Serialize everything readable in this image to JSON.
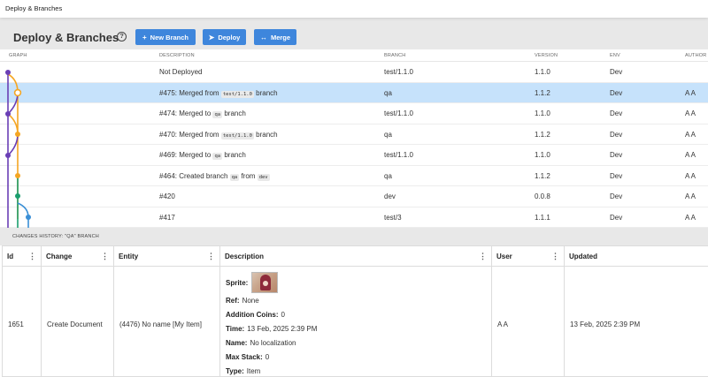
{
  "window": {
    "title": "Deploy & Branches"
  },
  "header": {
    "title": "Deploy & Branches",
    "help_icon": "?",
    "buttons": [
      {
        "label": "New Branch",
        "icon": "+"
      },
      {
        "label": "Deploy",
        "icon": "➤"
      },
      {
        "label": "Merge",
        "icon": "↔"
      }
    ]
  },
  "table": {
    "columns": [
      "GRAPH",
      "DESCRIPTION",
      "BRANCH",
      "VERSION",
      "ENV",
      "AUTHOR"
    ],
    "rows": [
      {
        "description": "Not Deployed",
        "branch": "test/1.1.0",
        "version": "1.1.0",
        "env": "Dev",
        "author": ""
      },
      {
        "d1": "#475: Merged from ",
        "code": "test/1.1.0",
        "d2": " branch",
        "branch": "qa",
        "version": "1.1.2",
        "env": "Dev",
        "author": "A A",
        "selected": true
      },
      {
        "d1": "#474: Merged to ",
        "code": "qa",
        "d2": " branch",
        "branch": "test/1.1.0",
        "version": "1.1.0",
        "env": "Dev",
        "author": "A A"
      },
      {
        "d1": "#470: Merged from ",
        "code": "test/1.1.0",
        "d2": " branch",
        "branch": "qa",
        "version": "1.1.2",
        "env": "Dev",
        "author": "A A"
      },
      {
        "d1": "#469: Merged to ",
        "code": "qa",
        "d2": " branch",
        "branch": "test/1.1.0",
        "version": "1.1.0",
        "env": "Dev",
        "author": "A A"
      },
      {
        "d1": "#464: Created branch ",
        "code": "qa",
        "d2": " from ",
        "code2": "dev",
        "branch": "qa",
        "version": "1.1.2",
        "env": "Dev",
        "author": "A A"
      },
      {
        "description": "#420",
        "branch": "dev",
        "version": "0.0.8",
        "env": "Dev",
        "author": "A A"
      },
      {
        "description": "#417",
        "branch": "test/3",
        "version": "1.1.1",
        "env": "Dev",
        "author": "A A"
      }
    ]
  },
  "graph_colors": {
    "purple": "#6a3fb5",
    "orange": "#f5a623",
    "green": "#1a9e6e",
    "blue": "#3a8fd6"
  },
  "history": {
    "title": "CHANGES HISTORY: \"QA\" BRANCH",
    "columns": [
      "Id",
      "Change",
      "Entity",
      "Description",
      "User",
      "Updated"
    ],
    "row": {
      "id": "1651",
      "change": "Create Document",
      "entity": "(4476) No name [My Item]",
      "user": "A A",
      "updated": "13 Feb, 2025 2:39 PM",
      "details": [
        {
          "label": "Sprite:",
          "value": ""
        },
        {
          "label": "Ref:",
          "value": "None"
        },
        {
          "label": "Addition Coins:",
          "value": "0"
        },
        {
          "label": "Time:",
          "value": "13 Feb, 2025 2:39 PM"
        },
        {
          "label": "Name:",
          "value": "No localization"
        },
        {
          "label": "Max Stack:",
          "value": "0"
        },
        {
          "label": "Type:",
          "value": "Item"
        }
      ]
    }
  }
}
